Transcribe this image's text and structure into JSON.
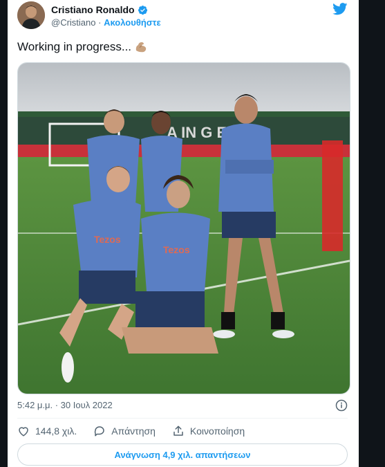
{
  "author": {
    "name": "Cristiano Ronaldo",
    "handle": "@Cristiano",
    "separator": "·",
    "follow_label": "Ακολουθήστε",
    "verified": true
  },
  "tweet": {
    "text": "Working in progress...",
    "emoji": "flexed-biceps",
    "timestamp": "5:42 μ.μ. · 30 Ιουλ 2022"
  },
  "photo": {
    "jersey_print": "Tezos",
    "banner_text": "A IN G E"
  },
  "actions": {
    "likes_count": "144,8 χιλ.",
    "reply_label": "Απάντηση",
    "share_label": "Κοινοποίηση"
  },
  "read_replies_label": "Ανάγνωση 4,9 χιλ. απαντήσεων",
  "colors": {
    "accent": "#1d9bf0",
    "text_primary": "#0f1419",
    "text_secondary": "#536471",
    "jersey": "#5a7fc4",
    "pitch": "#4f8a3a"
  }
}
